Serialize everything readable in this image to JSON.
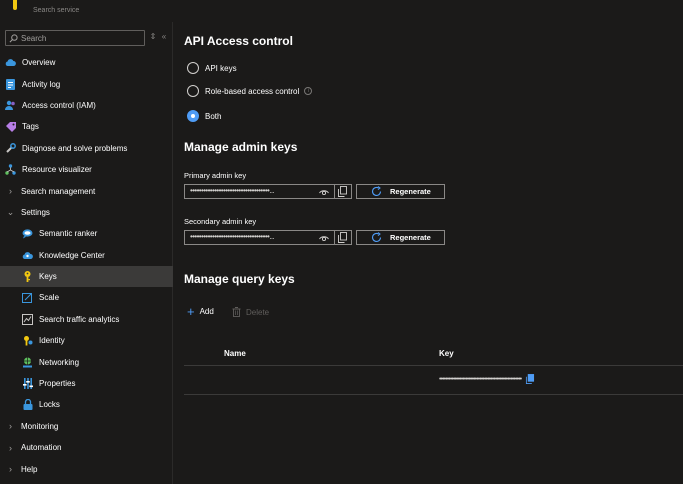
{
  "header": {
    "subtitle": "Search service"
  },
  "sidebar": {
    "search_placeholder": "Search",
    "items": [
      {
        "label": "Overview",
        "icon": "cloud-icon"
      },
      {
        "label": "Activity log",
        "icon": "activity-log-icon"
      },
      {
        "label": "Access control (IAM)",
        "icon": "people-icon"
      },
      {
        "label": "Tags",
        "icon": "tag-icon"
      },
      {
        "label": "Diagnose and solve problems",
        "icon": "wrench-icon"
      },
      {
        "label": "Resource visualizer",
        "icon": "network-icon"
      },
      {
        "label": "Search management",
        "expandable": true
      },
      {
        "label": "Settings",
        "expanded": true
      },
      {
        "label": "Semantic ranker",
        "icon": "lightbulb-icon"
      },
      {
        "label": "Knowledge Center",
        "icon": "cloud-people-icon"
      },
      {
        "label": "Keys",
        "icon": "key-icon",
        "active": true
      },
      {
        "label": "Scale",
        "icon": "scale-icon"
      },
      {
        "label": "Search traffic analytics",
        "icon": "chart-icon"
      },
      {
        "label": "Identity",
        "icon": "identity-icon"
      },
      {
        "label": "Networking",
        "icon": "networking-icon"
      },
      {
        "label": "Properties",
        "icon": "properties-icon"
      },
      {
        "label": "Locks",
        "icon": "lock-icon"
      },
      {
        "label": "Monitoring",
        "expandable": true
      },
      {
        "label": "Automation",
        "expandable": true
      },
      {
        "label": "Help",
        "expandable": true
      }
    ]
  },
  "main": {
    "api_access": {
      "title": "API Access control",
      "options": [
        "API keys",
        "Role-based access control",
        "Both"
      ],
      "selected": "Both"
    },
    "admin_keys": {
      "title": "Manage admin keys",
      "primary_label": "Primary admin key",
      "secondary_label": "Secondary admin key",
      "masked_value": "••••••••••••••••••••••••••••••••••••...",
      "regenerate_label": "Regenerate"
    },
    "query_keys": {
      "title": "Manage query keys",
      "add_label": "Add",
      "delete_label": "Delete",
      "columns": [
        "Name",
        "Key"
      ],
      "rows": [
        {
          "name": "",
          "key": "•••••••••••••••••••••••••••••••••••••••••••••••••••••"
        }
      ]
    }
  },
  "colors": {
    "accent": "#4f9cf5",
    "active_bg": "#3b3a39",
    "background": "#1b1a19"
  }
}
